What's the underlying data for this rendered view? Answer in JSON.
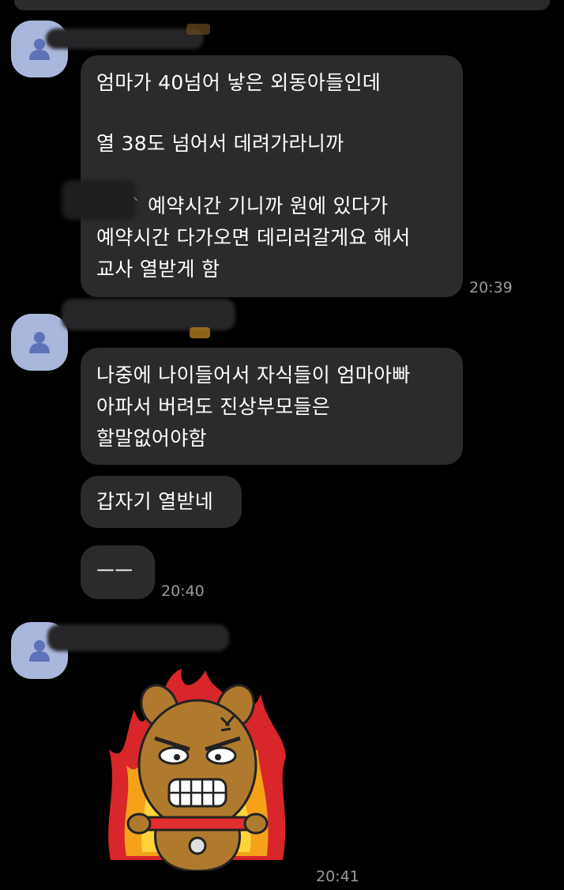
{
  "messages": [
    {
      "lines": [
        "엄마가 40넘어 낳은 외동아들인데",
        "열 38도 넘어서 데려가라니까",
        "` 예약시간 기니까 원에 있다가",
        "예약시간 다가오면 데리러갈게요 해서",
        "교사 열받게 함"
      ],
      "time": "20:39"
    },
    {
      "lines": [
        "나중에 나이들어서 자식들이 엄마아빠",
        "아파서 버려도 진상부모들은",
        "할말없어야함"
      ]
    },
    {
      "lines": [
        "갑자기 열받네"
      ]
    },
    {
      "lines": [
        "ㅡㅡ"
      ],
      "time": "20:40"
    }
  ],
  "sticker": {
    "name": "angry-bear-sticker",
    "time": "20:41"
  },
  "colors": {
    "background": "#000000",
    "bubble": "#2b2b2d",
    "avatar": "#a9b7dc",
    "avatar_icon": "#5d72b8",
    "timestamp": "#9a9aa0"
  }
}
